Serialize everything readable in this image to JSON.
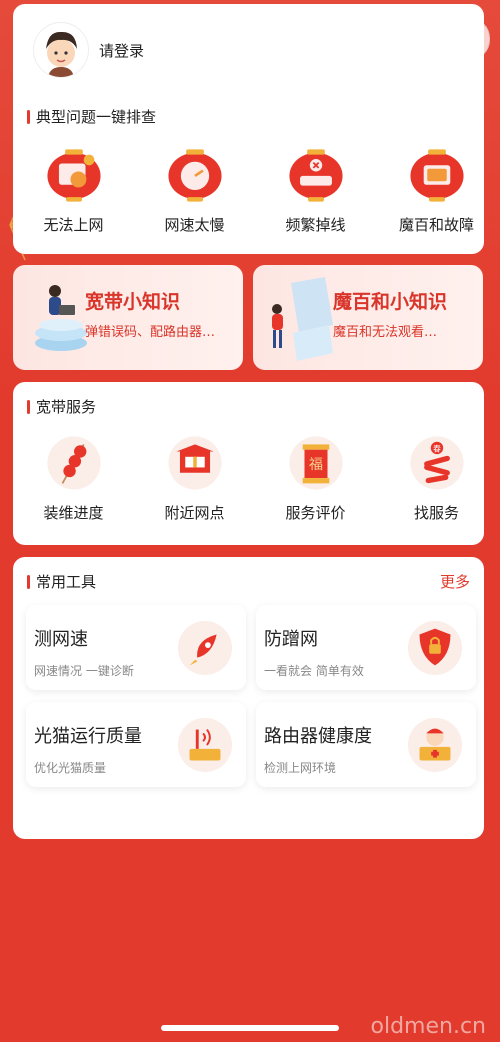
{
  "header": {
    "login_text": "请登录"
  },
  "capsule": {
    "menu_icon": "more-dots-icon",
    "close_icon": "target-circle-icon"
  },
  "typical_issues": {
    "title": "典型问题一键排查",
    "items": [
      {
        "label": "无法上网",
        "icon": "globe-lantern-icon"
      },
      {
        "label": "网速太慢",
        "icon": "speedometer-lantern-icon"
      },
      {
        "label": "频繁掉线",
        "icon": "router-lantern-icon"
      },
      {
        "label": "魔百和故障",
        "icon": "tv-lantern-icon"
      }
    ]
  },
  "banners": [
    {
      "title": "宽带小知识",
      "subtitle": "弹错误码、配路由器…"
    },
    {
      "title": "魔百和小知识",
      "subtitle": "魔百和无法观看…"
    }
  ],
  "broadband_service": {
    "title": "宽带服务",
    "items": [
      {
        "label": "装维进度",
        "icon": "candied-haws-icon"
      },
      {
        "label": "附近网点",
        "icon": "gate-icon"
      },
      {
        "label": "服务评价",
        "icon": "fu-scroll-icon"
      },
      {
        "label": "找服务",
        "icon": "firecracker-icon"
      }
    ]
  },
  "tools": {
    "title": "常用工具",
    "more_label": "更多",
    "items": [
      {
        "title": "测网速",
        "subtitle": "网速情况 一键诊断",
        "icon": "rocket-icon"
      },
      {
        "title": "防蹭网",
        "subtitle": "一看就会 简单有效",
        "icon": "shield-lock-icon"
      },
      {
        "title": "光猫运行质量",
        "subtitle": "优化光猫质量",
        "icon": "modem-icon"
      },
      {
        "title": "路由器健康度",
        "subtitle": "检测上网环境",
        "icon": "router-doctor-icon"
      }
    ]
  },
  "watermark": "oldmen.cn",
  "colors": {
    "background": "#e23a2d",
    "accent": "#e23a2d",
    "banner_text": "#d9352a"
  }
}
